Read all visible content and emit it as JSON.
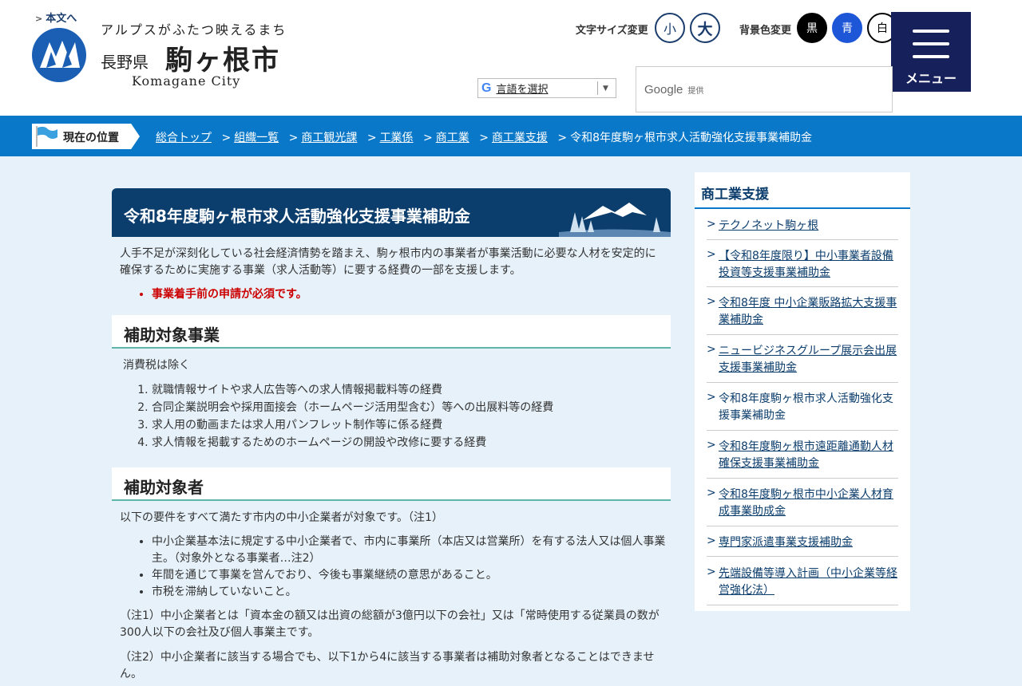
{
  "header": {
    "skip_link": "本文へ",
    "tagline": "アルプスがふたつ映えるまち",
    "pref": "長野県",
    "city": "駒ヶ根市",
    "city_en": "Komagane City",
    "font_size_label": "文字サイズ変更",
    "font_small": "小",
    "font_large": "大",
    "bg_label": "背景色変更",
    "bg_black": "黒",
    "bg_blue": "青",
    "bg_white": "白",
    "menu_label": "メニュー",
    "translate_icon": "G",
    "translate_label": "言語を選択",
    "translate_arrow": "▼",
    "search_google": "Google",
    "search_provided": "提供"
  },
  "breadcrumb": {
    "label": "現在の位置",
    "items": [
      "総合トップ",
      "組織一覧",
      "商工観光課",
      "工業係",
      "商工業",
      "商工業支援"
    ],
    "current": "令和8年度駒ヶ根市求人活動強化支援事業補助金"
  },
  "main": {
    "title": "令和8年度駒ヶ根市求人活動強化支援事業補助金",
    "intro": "人手不足が深刻化している社会経済情勢を踏まえ、駒ヶ根市内の事業者が事業活動に必要な人材を安定的に確保するために実施する事業（求人活動等）に要する経費の一部を支援します。",
    "notice": "事業着手前の申請が必須です。",
    "section1_title": "補助対象事業",
    "section1_note": "消費税は除く",
    "section1_items": [
      "就職情報サイトや求人広告等への求人情報掲載料等の経費",
      "合同企業説明会や採用面接会（ホームページ活用型含む）等への出展料等の経費",
      "求人用の動画または求人用パンフレット制作等に係る経費",
      "求人情報を掲載するためのホームページの開設や改修に要する経費"
    ],
    "section2_title": "補助対象者",
    "section2_intro": "以下の要件をすべて満たす市内の中小企業者が対象です。（注1）",
    "section2_items": [
      "中小企業基本法に規定する中小企業者で、市内に事業所（本店又は営業所）を有する法人又は個人事業主。（対象外となる事業者…注2）",
      "年間を通じて事業を営んでおり、今後も事業継続の意思があること。",
      "市税を滞納していないこと。"
    ],
    "note1": "（注1）中小企業者とは「資本金の額又は出資の総額が3億円以下の会社」又は「常時使用する従業員の数が300人以下の会社及び個人事業主です。",
    "note2": "（注2）中小企業者に該当する場合でも、以下1から4に該当する事業者は補助対象者となることはできません。"
  },
  "sidebar": {
    "title": "商工業支援",
    "items": [
      "テクノネット駒ヶ根",
      "【令和8年度限り】中小事業者設備投資等支援事業補助金",
      "令和8年度 中小企業販路拡大支援事業補助金",
      "ニュービジネスグループ展示会出展支援事業補助金",
      "令和8年度駒ヶ根市求人活動強化支援事業補助金",
      "令和8年度駒ヶ根市遠距離通勤人材確保支援事業補助金",
      "令和8年度駒ヶ根市中小企業人材育成事業助成金",
      "専門家派遣事業支援補助金",
      "先端設備等導入計画（中小企業等経営強化法）"
    ]
  },
  "colors": {
    "navy": "#0b3d6d",
    "menu_bg": "#16205a",
    "breadcrumb_bg": "#0a78c8",
    "page_bg": "#e6f1f9",
    "notice_red": "#cc0000",
    "heading_rule": "#5fb6a8"
  }
}
